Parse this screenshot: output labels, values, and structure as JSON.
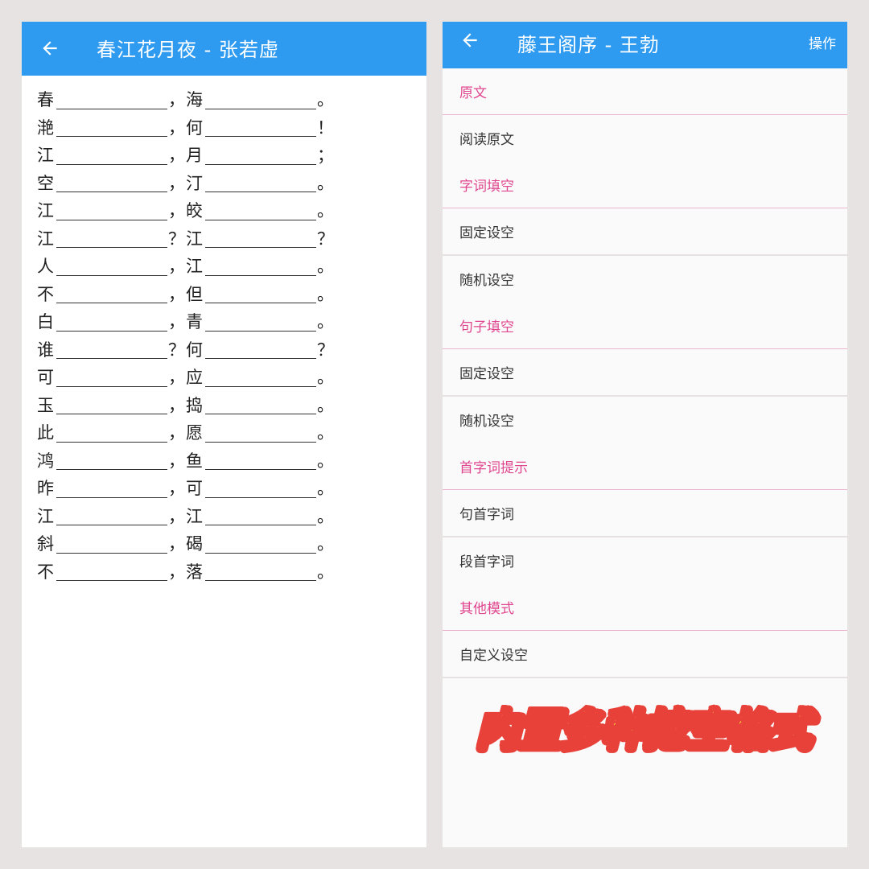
{
  "left": {
    "title": "春江花月夜 - 张若虚",
    "lines": [
      {
        "c1": "春",
        "p1": "，",
        "c2": "海",
        "p2": "。"
      },
      {
        "c1": "滟",
        "p1": "，",
        "c2": "何",
        "p2": "！"
      },
      {
        "c1": "江",
        "p1": "，",
        "c2": "月",
        "p2": "；"
      },
      {
        "c1": "空",
        "p1": "，",
        "c2": "汀",
        "p2": "。"
      },
      {
        "c1": "江",
        "p1": "，",
        "c2": "皎",
        "p2": "。"
      },
      {
        "c1": "江",
        "p1": "？",
        "c2": "江",
        "p2": "？"
      },
      {
        "c1": "人",
        "p1": "，",
        "c2": "江",
        "p2": "。"
      },
      {
        "c1": "不",
        "p1": "，",
        "c2": "但",
        "p2": "。"
      },
      {
        "c1": "白",
        "p1": "，",
        "c2": "青",
        "p2": "。"
      },
      {
        "c1": "谁",
        "p1": "？",
        "c2": "何",
        "p2": "？"
      },
      {
        "c1": "可",
        "p1": "，",
        "c2": "应",
        "p2": "。"
      },
      {
        "c1": "玉",
        "p1": "，",
        "c2": "捣",
        "p2": "。"
      },
      {
        "c1": "此",
        "p1": "，",
        "c2": "愿",
        "p2": "。"
      },
      {
        "c1": "鸿",
        "p1": "，",
        "c2": "鱼",
        "p2": "。"
      },
      {
        "c1": "昨",
        "p1": "，",
        "c2": "可",
        "p2": "。"
      },
      {
        "c1": "江",
        "p1": "，",
        "c2": "江",
        "p2": "。"
      },
      {
        "c1": "斜",
        "p1": "，",
        "c2": "碣",
        "p2": "。"
      },
      {
        "c1": "不",
        "p1": "，",
        "c2": "落",
        "p2": "。"
      }
    ]
  },
  "right": {
    "title": "藤王阁序 - 王勃",
    "action_label": "操作",
    "menu": {
      "h_original": "原文",
      "read_original": "阅读原文",
      "h_word_fill": "字词填空",
      "word_fixed": "固定设空",
      "word_random": "随机设空",
      "h_sentence_fill": "句子填空",
      "sentence_fixed": "固定设空",
      "sentence_random": "随机设空",
      "h_first_char": "首字词提示",
      "sentence_first": "句首字词",
      "paragraph_first": "段首字词",
      "h_other": "其他模式",
      "custom_blank": "自定义设空"
    },
    "promo_text": "内置多种挖空格式"
  },
  "colors": {
    "appbar": "#2f9bf0",
    "section_header": "#e0468f",
    "promo_fill": "#ffd23c",
    "promo_stroke": "#e8413a"
  }
}
